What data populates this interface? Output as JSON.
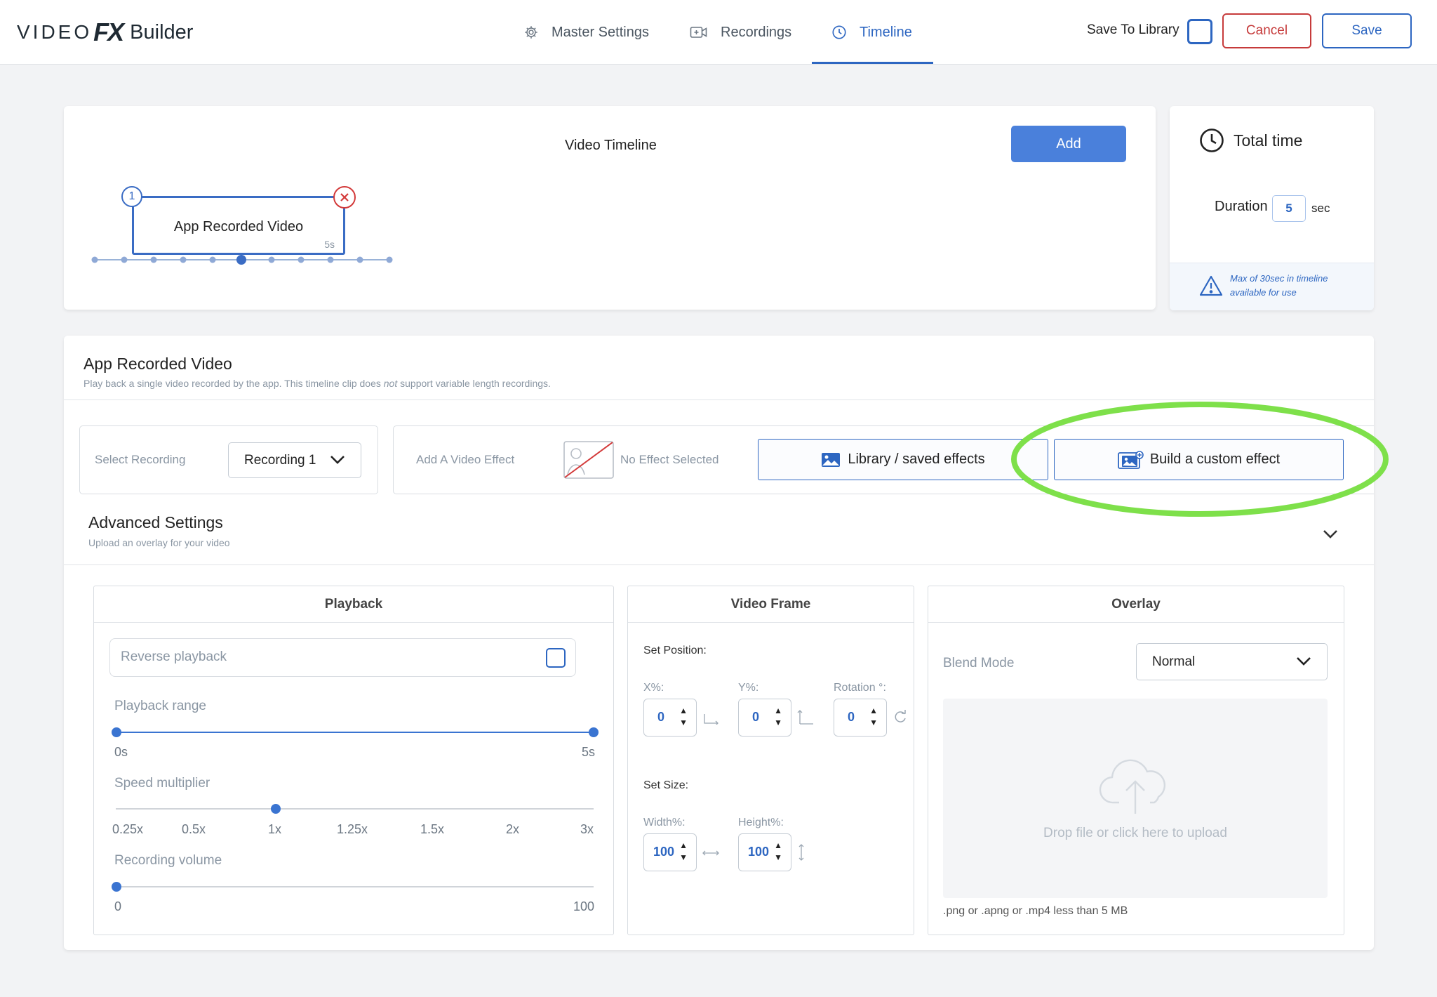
{
  "header": {
    "logo": {
      "video": "VIDEO",
      "fx": "FX",
      "builder": "Builder"
    },
    "tabs": [
      {
        "label": "Master Settings",
        "icon": "gear-icon"
      },
      {
        "label": "Recordings",
        "icon": "video-add-icon"
      },
      {
        "label": "Timeline",
        "icon": "clock-icon",
        "active": true
      }
    ],
    "save_to_library_label": "Save To Library",
    "cancel_label": "Cancel",
    "save_label": "Save"
  },
  "timeline": {
    "title": "Video Timeline",
    "add_label": "Add",
    "clips": [
      {
        "number": "1",
        "label": "App Recorded Video",
        "duration": "5s"
      }
    ]
  },
  "total_time": {
    "title": "Total time",
    "duration_label": "Duration",
    "duration_value": "5",
    "duration_unit": "sec",
    "note": "Max of 30sec in timeline available for use"
  },
  "clip_detail": {
    "title": "App Recorded Video",
    "subtitle_pre": "Play back a single video recorded by the app. This timeline clip does ",
    "subtitle_em": "not",
    "subtitle_post": " support variable length recordings.",
    "select_recording_label": "Select Recording",
    "recording_value": "Recording 1",
    "add_effect_label": "Add A Video Effect",
    "no_effect_label": "No Effect Selected",
    "library_button": "Library / saved effects",
    "custom_button": "Build a custom effect"
  },
  "advanced": {
    "title": "Advanced Settings",
    "subtitle": "Upload an overlay for your video"
  },
  "playback": {
    "title": "Playback",
    "reverse_label": "Reverse playback",
    "reverse_checked": false,
    "range_label": "Playback range",
    "range_min": "0s",
    "range_max": "5s",
    "range_start": 0,
    "range_end": 5,
    "speed_label": "Speed multiplier",
    "speed_ticks": [
      "0.25x",
      "0.5x",
      "1x",
      "1.25x",
      "1.5x",
      "2x",
      "3x"
    ],
    "speed_selected": "1x",
    "volume_label": "Recording volume",
    "volume_min": "0",
    "volume_max": "100",
    "volume_value": 0
  },
  "video_frame": {
    "title": "Video Frame",
    "set_position": "Set Position:",
    "x_label": "X%:",
    "x_value": "0",
    "y_label": "Y%:",
    "y_value": "0",
    "rotation_label": "Rotation °:",
    "rotation_value": "0",
    "set_size": "Set Size:",
    "width_label": "Width%:",
    "width_value": "100",
    "height_label": "Height%:",
    "height_value": "100"
  },
  "overlay": {
    "title": "Overlay",
    "blend_label": "Blend Mode",
    "blend_value": "Normal",
    "upload_text": "Drop file or click here to upload",
    "file_hint": ".png or .apng or .mp4 less than 5 MB"
  },
  "colors": {
    "accent": "#2d66c1",
    "add_button": "#4a80db",
    "danger": "#c63b3b",
    "highlight_circle": "#7ee04a"
  }
}
